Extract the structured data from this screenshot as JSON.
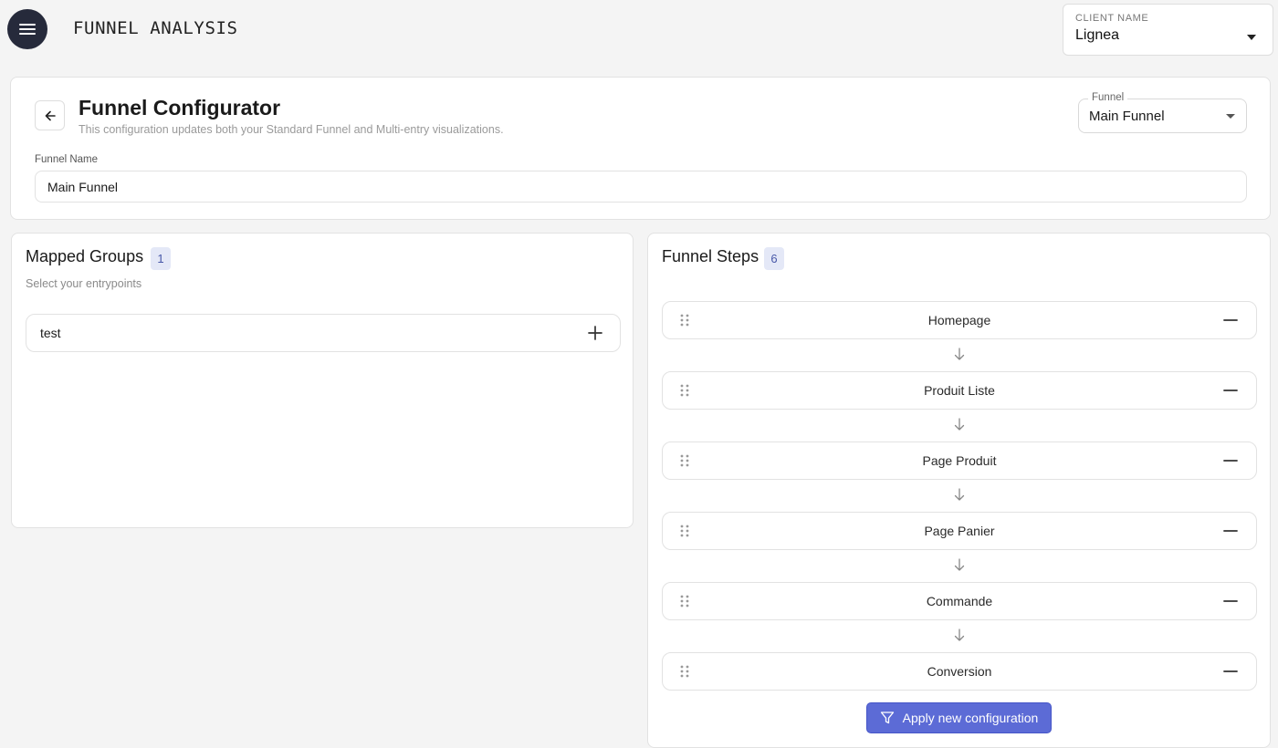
{
  "header": {
    "app_title": "FUNNEL ANALYSIS",
    "menu_icon": "hamburger-menu-icon",
    "client_select": {
      "label": "CLIENT NAME",
      "value": "Lignea"
    }
  },
  "configurator": {
    "title": "Funnel Configurator",
    "subtitle": "This configuration updates both your Standard Funnel and Multi-entry visualizations.",
    "back_icon": "arrow-left-icon",
    "funnel_select": {
      "label": "Funnel",
      "value": "Main Funnel"
    },
    "funnel_name": {
      "label": "Funnel Name",
      "value": "Main Funnel"
    }
  },
  "mapped_groups": {
    "title": "Mapped Groups",
    "count": "1",
    "subtitle": "Select your entrypoints",
    "items": [
      {
        "label": "test"
      }
    ]
  },
  "funnel_steps": {
    "title": "Funnel Steps",
    "count": "6",
    "steps": [
      {
        "label": "Homepage"
      },
      {
        "label": "Produit Liste"
      },
      {
        "label": "Page Produit"
      },
      {
        "label": "Page Panier"
      },
      {
        "label": "Commande"
      },
      {
        "label": "Conversion"
      }
    ],
    "apply_label": "Apply new configuration"
  },
  "colors": {
    "accent": "#5c6bd6",
    "menu_button": "#262a3b",
    "badge_bg": "#e4e8f7",
    "badge_text": "#4858a8",
    "background": "#f4f4f4"
  }
}
